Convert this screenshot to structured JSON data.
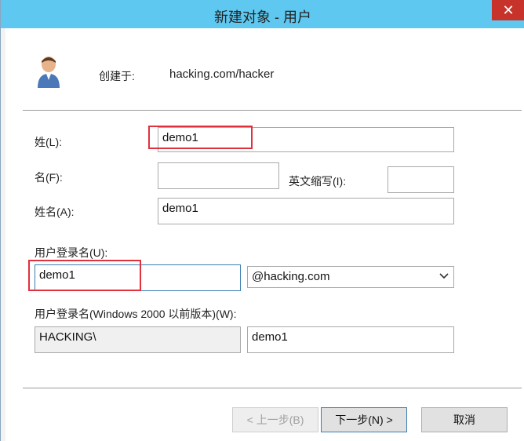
{
  "window": {
    "title": "新建对象 - 用户",
    "close_symbol": "✕"
  },
  "header": {
    "created_in_label": "创建于:",
    "created_in_value": "hacking.com/hacker"
  },
  "fields": {
    "last_name": {
      "label": "姓(L):",
      "value": "demo1"
    },
    "first_name": {
      "label": "名(F):",
      "value": ""
    },
    "initials": {
      "label": "英文缩写(I):",
      "value": ""
    },
    "full_name": {
      "label": "姓名(A):",
      "value": "demo1"
    },
    "logon_name": {
      "label": "用户登录名(U):",
      "value": "demo1",
      "domain_selected": "@hacking.com"
    },
    "pre2000_logon": {
      "label": "用户登录名(Windows 2000 以前版本)(W):",
      "domain_prefix": "HACKING\\",
      "value": "demo1"
    }
  },
  "buttons": {
    "back": "< 上一步(B)",
    "next": "下一步(N) >",
    "cancel": "取消"
  },
  "icons": {
    "user": "user-icon",
    "chevron": "chevron-down-icon",
    "close": "close-icon"
  },
  "colors": {
    "titlebar": "#5ec8f0",
    "close": "#c7332b",
    "highlight": "#e0323d"
  }
}
